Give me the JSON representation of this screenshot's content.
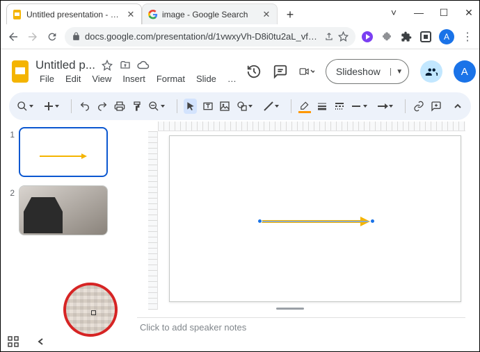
{
  "browser": {
    "tabs": [
      {
        "title": "Untitled presentation - Google S",
        "active": true
      },
      {
        "title": "image - Google Search",
        "active": false
      }
    ],
    "url": "docs.google.com/presentation/d/1vwxyVh-D8i0tu2aL_vfNHfpQ...",
    "avatar_letter": "A"
  },
  "app": {
    "doc_title": "Untitled p...",
    "menus": [
      "File",
      "Edit",
      "View",
      "Insert",
      "Format",
      "Slide",
      "…"
    ],
    "slideshow_label": "Slideshow",
    "avatar_letter": "A"
  },
  "filmstrip": {
    "slides": [
      {
        "num": "1",
        "selected": true
      },
      {
        "num": "2",
        "selected": false
      }
    ]
  },
  "notes": {
    "placeholder": "Click to add speaker notes"
  }
}
